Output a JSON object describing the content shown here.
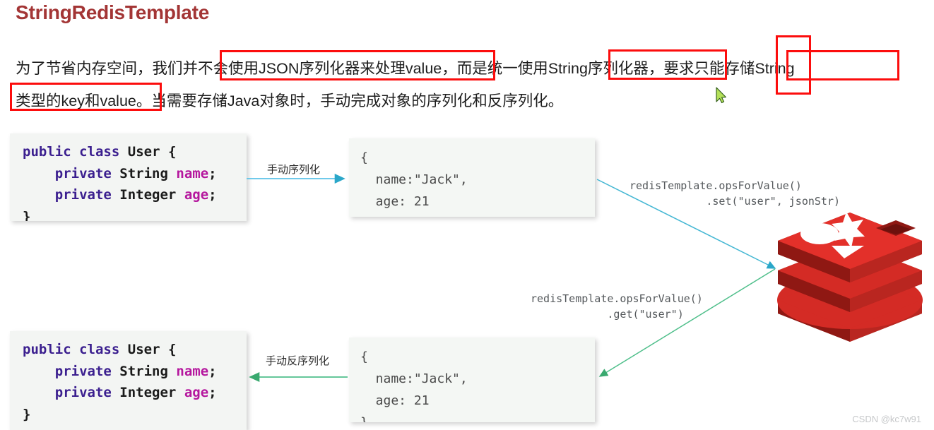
{
  "page": {
    "title": "StringRedisTemplate",
    "title_color": "#a33535",
    "background": "#ffffff",
    "watermark": "CSDN @kc7w91"
  },
  "paragraph": {
    "line1": "为了节省内存空间，我们并不会使用JSON序列化器来处理value，而是统一使用String序列化器，要求只能存储String",
    "line2": "类型的key和value。当需要存储Java对象时，手动完成对象的序列化和反序列化。",
    "highlight_color": "#fc0d0d",
    "highlights": [
      "不会使用JSON序列化器来处理value",
      "类型的key和value。",
      "String序列化器",
      "只能",
      "存储String"
    ]
  },
  "code_top": {
    "line1_kw1": "public",
    "line1_kw2": "class",
    "line1_name": "User",
    "line1_brace": "{",
    "line2_kw": "private",
    "line2_type": "String",
    "line2_field": "name",
    "line2_semi": ";",
    "line3_kw": "private",
    "line3_type": "Integer",
    "line3_field": "age",
    "line3_semi": ";",
    "line4_brace": "}"
  },
  "code_bottom": {
    "line1_kw1": "public",
    "line1_kw2": "class",
    "line1_name": "User",
    "line1_brace": "{",
    "line2_kw": "private",
    "line2_type": "String",
    "line2_field": "name",
    "line2_semi": ";",
    "line3_kw": "private",
    "line3_type": "Integer",
    "line3_field": "age",
    "line3_semi": ";",
    "line4_brace": "}"
  },
  "json_top": {
    "text": "{\n  name:\"Jack\",\n  age: 21\n}"
  },
  "json_bottom": {
    "text": "{\n  name:\"Jack\",\n  age: 21\n}"
  },
  "arrows": {
    "serialize_label": "手动序列化",
    "deserialize_label": "手动反序列化",
    "serialize_color": "#5cc3e8",
    "deserialize_color": "#4fbf8b",
    "set_note": "redisTemplate.opsForValue()\n            .set(\"user\", jsonStr)",
    "get_note": "redisTemplate.opsForValue()\n            .get(\"user\")",
    "set_arrow_color": "#2aa7c9",
    "get_arrow_color": "#39a96f"
  },
  "redis_logo": {
    "name": "redis-logo",
    "color_top": "#e3302a",
    "color_mid": "#d42b25",
    "color_dark": "#a52019",
    "color_shade": "#c4241e"
  },
  "cursor": {
    "name": "mouse-pointer",
    "fill": "#b4e05a",
    "stroke": "#2d5a16"
  }
}
